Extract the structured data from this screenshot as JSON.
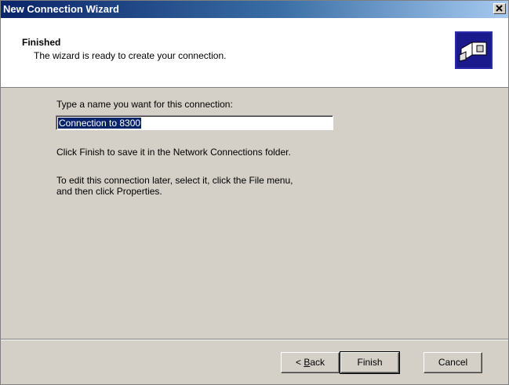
{
  "window": {
    "title": "New Connection Wizard"
  },
  "header": {
    "title": "Finished",
    "subtitle": "The wizard is ready to create your connection."
  },
  "body": {
    "prompt": "Type a name you want for this connection:",
    "connection_name": "Connection to 8300",
    "info_line_1": "Click Finish to save it in the Network Connections folder.",
    "info_line_2a": "To edit this connection later, select it, click the File menu,",
    "info_line_2b": "and then click Properties."
  },
  "buttons": {
    "back_mnemonic": "B",
    "back_rest": "ack",
    "back_prefix": "< ",
    "finish": "Finish",
    "cancel": "Cancel"
  },
  "icons": {
    "close": "close-icon",
    "header": "network-connection-icon"
  },
  "colors": {
    "titlebar_start": "#0a246a",
    "titlebar_end": "#a6caf0",
    "selection": "#0a246a"
  }
}
